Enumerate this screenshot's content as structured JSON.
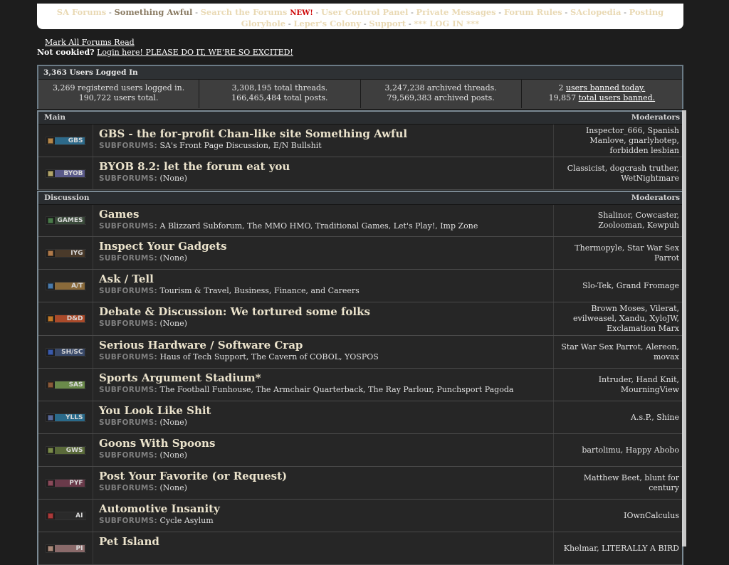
{
  "nav": {
    "items": [
      {
        "label": "SA Forums",
        "dark": false
      },
      {
        "label": "Something Awful",
        "dark": true
      },
      {
        "label": "Search the Forums",
        "dark": false,
        "new": "NEW!"
      },
      {
        "label": "User Control Panel",
        "dark": false
      },
      {
        "label": "Private Messages",
        "dark": false
      },
      {
        "label": "Forum Rules",
        "dark": false
      },
      {
        "label": "SAclopedia",
        "dark": false
      },
      {
        "label": "Posting Gloryhole",
        "dark": false
      },
      {
        "label": "Leper's Colony",
        "dark": false
      },
      {
        "label": "Support",
        "dark": false
      },
      {
        "label": "*** LOG IN ***",
        "dark": false
      }
    ]
  },
  "mark_all": "Mark All Forums Read",
  "cookie": {
    "prefix": "Not cookied?",
    "link": "Login here! PLEASE DO IT, WE'RE SO EXCITED!"
  },
  "stats": {
    "header": "3,363 Users Logged In",
    "cells": [
      {
        "l1": "3,269 registered users logged in.",
        "l2": "190,722 users total."
      },
      {
        "l1": "3,308,195 total threads.",
        "l2": "166,465,484 total posts."
      },
      {
        "l1": "3,247,238 archived threads.",
        "l2": "79,569,383 archived posts."
      },
      {
        "l1pre": "2 ",
        "l1link": "users banned today.",
        "l2pre": "19,857 ",
        "l2link": "total users banned."
      }
    ]
  },
  "subforums_label": "SUBFORUMS:",
  "sections": [
    {
      "name": "Main",
      "moderators_label": "Moderators",
      "forums": [
        {
          "tag": "GBS",
          "swatch": "#b5874a",
          "tagbg": "#2d6a8a",
          "title": "GBS - the for-profit Chan-like site Something Awful",
          "subforums": "SA's Front Page Discussion, E/N Bullshit",
          "moderators": "Inspector_666, Spanish Manlove, gnarlyhotep, forbidden lesbian"
        },
        {
          "tag": "BYOB",
          "swatch": "#b3a56a",
          "tagbg": "#5a5a8a",
          "title": "BYOB 8.2: let the forum eat you",
          "subforums": "(None)",
          "moderators": "Classicist, dogcrash truther, WetNightmare"
        }
      ]
    },
    {
      "name": "Discussion",
      "moderators_label": "Moderators",
      "forums": [
        {
          "tag": "GAMES",
          "swatch": "#4a7a4a",
          "tagbg": "#3a4a3a",
          "title": "Games",
          "subforums": "A Blizzard Subforum, The MMO HMO, Traditional Games, Let's Play!, Imp Zone",
          "moderators": "Shalinor, Cowcaster, Zoolooman, Kewpuh"
        },
        {
          "tag": "IYG",
          "swatch": "#b07a4a",
          "tagbg": "#4a3a2a",
          "title": "Inspect Your Gadgets",
          "subforums": "(None)",
          "moderators": "Thermopyle, Star War Sex Parrot"
        },
        {
          "tag": "A/T",
          "swatch": "#4a7aaa",
          "tagbg": "#8a6a3a",
          "title": "Ask / Tell",
          "subforums": "Tourism & Travel, Business, Finance, and Careers",
          "moderators": "Slo-Tek, Grand Fromage"
        },
        {
          "tag": "D&D",
          "swatch": "#c07a2a",
          "tagbg": "#aa4a2a",
          "title": "Debate & Discussion: We tortured some folks",
          "subforums": "(None)",
          "moderators": "Brown Moses, Vilerat, evilweasel, Xandu, XyloJW, Exclamation Marx"
        },
        {
          "tag": "SH/SC",
          "swatch": "#3a5aaa",
          "tagbg": "#3a4a6a",
          "title": "Serious Hardware / Software Crap",
          "subforums": "Haus of Tech Support, The Cavern of COBOL, YOSPOS",
          "moderators": "Star War Sex Parrot, Alereon, movax"
        },
        {
          "tag": "SAS",
          "swatch": "#8a5a3a",
          "tagbg": "#6a8a4a",
          "title": "Sports Argument Stadium*",
          "subforums": "The Football Funhouse, The Armchair Quarterback, The Ray Parlour, Punchsport Pagoda",
          "moderators": "Intruder, Hand Knit, MourningView"
        },
        {
          "tag": "YLLS",
          "swatch": "#5a6a9a",
          "tagbg": "#2a6a8a",
          "title": "You Look Like Shit",
          "subforums": "(None)",
          "moderators": "A.s.P., Shine"
        },
        {
          "tag": "GWS",
          "swatch": "#7a8a4a",
          "tagbg": "#5a6a3a",
          "title": "Goons With Spoons",
          "subforums": "(None)",
          "moderators": "bartolimu, Happy Abobo"
        },
        {
          "tag": "PYF",
          "swatch": "#8a4a5a",
          "tagbg": "#6a3a4a",
          "title": "Post Your Favorite (or Request)",
          "subforums": "(None)",
          "moderators": "Matthew Beet, blunt for century"
        },
        {
          "tag": "AI",
          "swatch": "#aa3a3a",
          "tagbg": "#2a2a2a",
          "title": "Automotive Insanity",
          "subforums": "Cycle Asylum",
          "moderators": "IOwnCalculus"
        },
        {
          "tag": "PI",
          "swatch": "#aa8a7a",
          "tagbg": "#8a6a6a",
          "title": "Pet Island",
          "subforums": "",
          "moderators": "Khelmar, LITERALLY A BIRD"
        }
      ]
    }
  ]
}
